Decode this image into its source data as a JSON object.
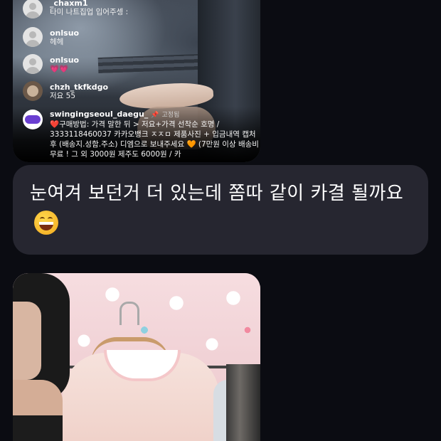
{
  "stream_screenshot": {
    "comments": [
      {
        "username": "_chaxm1",
        "message": "타미 나트집업 입어주셍 :"
      },
      {
        "username": "onlsuo",
        "message": "헤헤"
      },
      {
        "username": "onlsuo",
        "message": "💗💗"
      },
      {
        "username": "chzh_tkfkdgo",
        "message": "저요 55"
      }
    ],
    "pinned_comment": {
      "username": "swingingseoul_daegu_",
      "pinned_label": "고정됨",
      "message": "❤️구매방법: 가격 말한 뒤 > 저요+가격 선착순 호명 / 3333118460037 카카오뱅크 ㅈㅈㅁ 제품사진 + 입금내역 캡처 후 (배송지.성함.주소) 디엠으로 보내주세요 🧡 (7만원 이상 배송비 무료 ! 그 외 3000원 제주도 6000원 / 카"
    }
  },
  "message_bubble": {
    "text": "눈여겨 보던거 더 있는데 쫌따 같이 카결 될까요",
    "emoji": "grinning-squinting-face"
  },
  "photo": {
    "description_icon": "photo-attachment"
  }
}
